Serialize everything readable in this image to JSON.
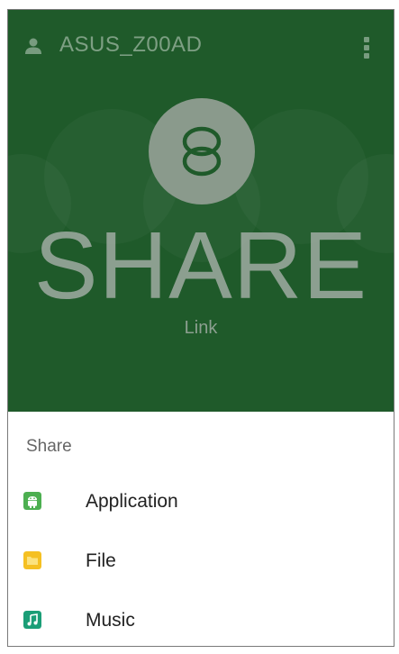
{
  "header": {
    "device_name": "ASUS_Z00AD",
    "person_icon": "person-icon",
    "menu_icon": "overflow-menu-icon"
  },
  "hero": {
    "logo_icon": "share-link-logo-icon",
    "title": "SHARE",
    "subtitle": "Link",
    "background_color": "#1f5a2a"
  },
  "sheet": {
    "title": "Share",
    "items": [
      {
        "label": "Application",
        "icon": "android-icon",
        "color": "#4caf50"
      },
      {
        "label": "File",
        "icon": "folder-icon",
        "color": "#f5c022"
      },
      {
        "label": "Music",
        "icon": "music-note-icon",
        "color": "#1b9e77"
      }
    ]
  }
}
